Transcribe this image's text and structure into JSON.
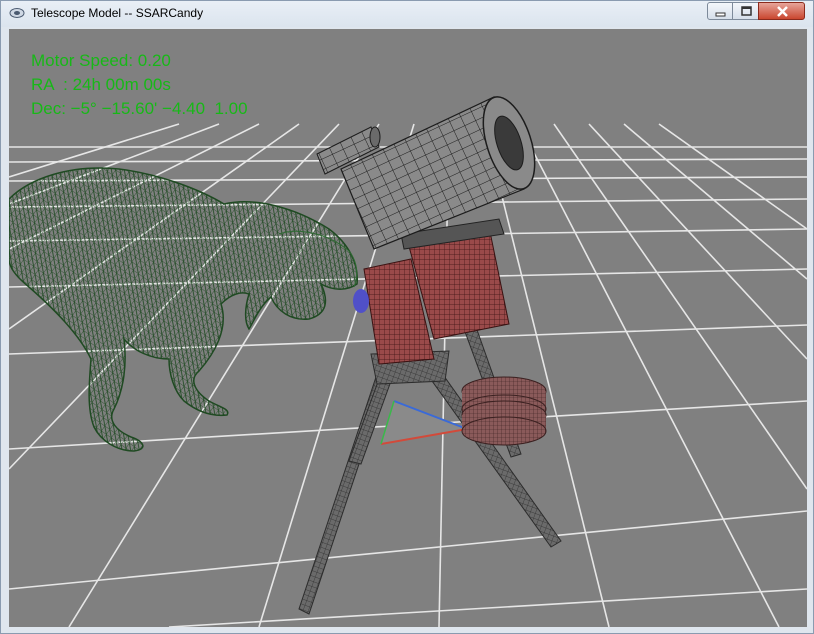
{
  "window": {
    "title": "Telescope Model -- SSARCandy",
    "icon": "app-icon",
    "controls": [
      "minimize-icon",
      "maximize-icon",
      "close-icon"
    ]
  },
  "hud": {
    "motor_speed": "Motor Speed: 0.20",
    "ra": "RA  : 24h 00m 00s",
    "dec": "Dec: −5° −15.60' −4.40  1.00"
  },
  "colors": {
    "hud_text": "#17b817",
    "background": "#808080",
    "grid": "#ffffff",
    "dinosaur": "#1f4a22",
    "tube": "#3a3a3a",
    "mount": "#8a3a3a",
    "tripod": "#555555"
  }
}
